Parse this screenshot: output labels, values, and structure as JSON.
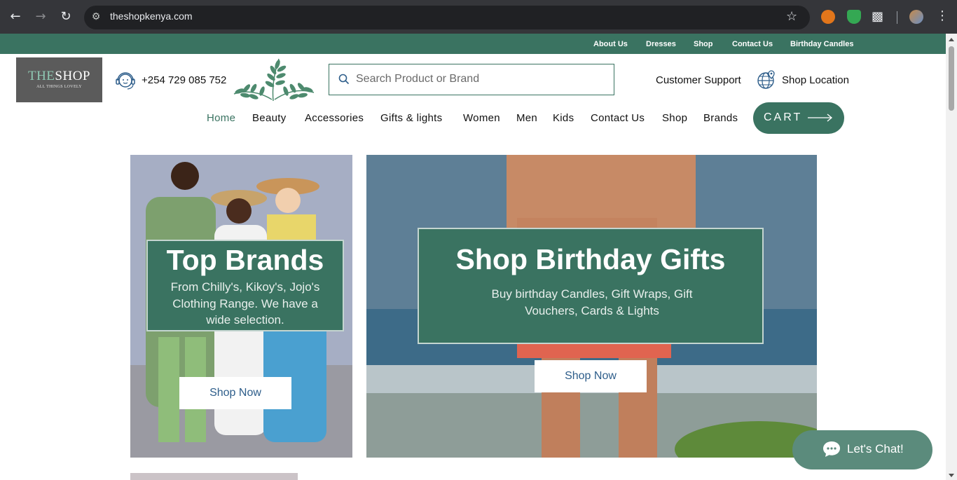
{
  "browser": {
    "url": "theshopkenya.com"
  },
  "top_links": [
    "About Us",
    "Dresses",
    "Shop",
    "Contact Us",
    "Birthday Candles"
  ],
  "header": {
    "logo_the": "THE",
    "logo_shop": "SHOP",
    "logo_tagline": "ALL THINGS LOVELY",
    "phone": "+254 729 085 752",
    "search_placeholder": "Search Product or Brand",
    "support_label": "Customer Support",
    "location_label": "Shop Location"
  },
  "menu": {
    "items": [
      "Home",
      "Beauty",
      "Accessories",
      "Gifts & lights",
      "Women",
      "Men",
      "Kids",
      "Contact Us",
      "Shop",
      "Brands"
    ],
    "active": "Home",
    "cart_label": "CART"
  },
  "banners": [
    {
      "title": "Top Brands",
      "description": "From Chilly's, Kikoy's, Jojo's Clothing Range. We have a wide selection.",
      "button": "Shop Now"
    },
    {
      "title": "Shop Birthday Gifts",
      "description": "Buy birthday Candles, Gift Wraps, Gift Vouchers, Cards & Lights",
      "button": "Shop Now"
    }
  ],
  "chat": {
    "label": "Let's Chat!"
  },
  "colors": {
    "brand_green": "#3a7361",
    "chat_green": "#5b8b7c",
    "link_blue": "#2d5d8a"
  }
}
